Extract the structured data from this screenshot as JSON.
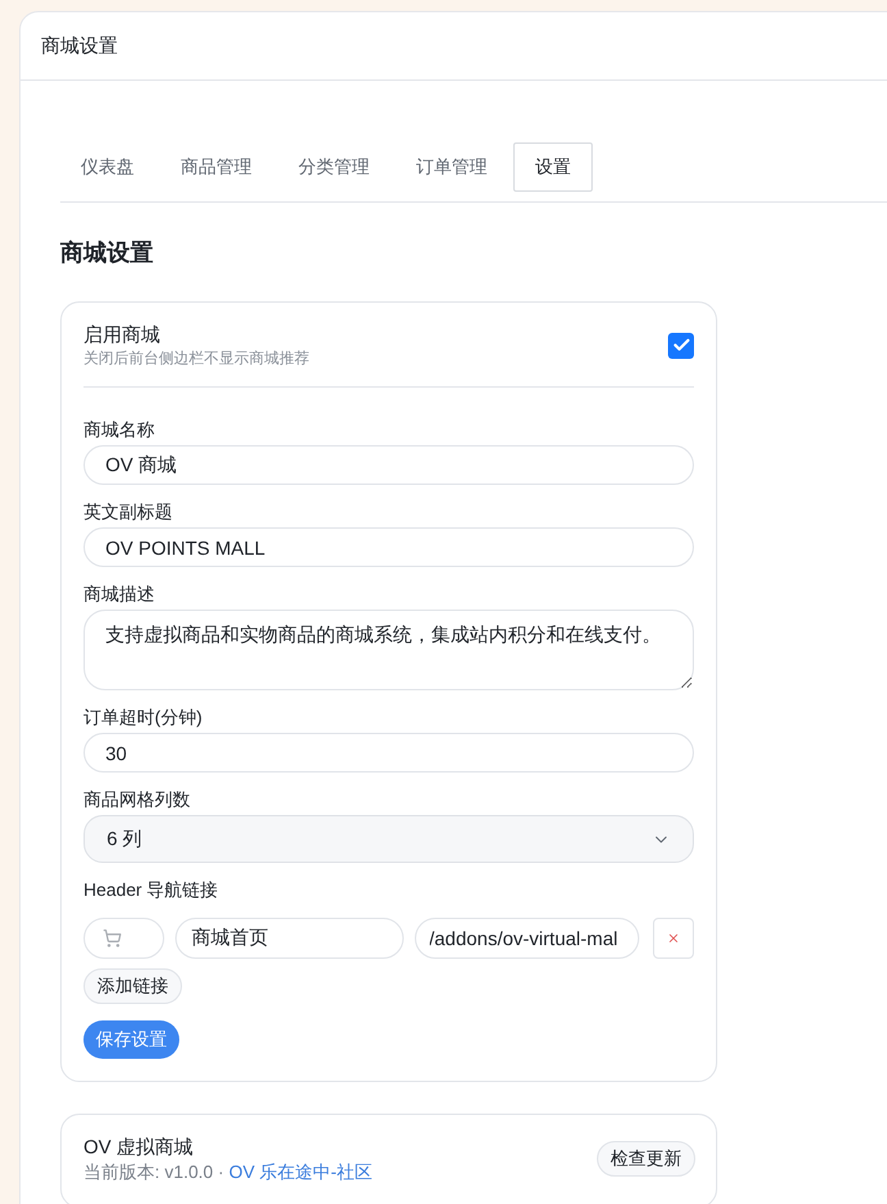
{
  "page": {
    "title": "商城设置"
  },
  "tabs": [
    {
      "label": "仪表盘",
      "selected": false
    },
    {
      "label": "商品管理",
      "selected": false
    },
    {
      "label": "分类管理",
      "selected": false
    },
    {
      "label": "订单管理",
      "selected": false
    },
    {
      "label": "设置",
      "selected": true
    }
  ],
  "section_title": "商城设置",
  "settings_card": {
    "enable": {
      "label": "启用商城",
      "description": "关闭后前台侧边栏不显示商城推荐",
      "checked": true
    },
    "fields": [
      {
        "kind": "text",
        "label": "商城名称",
        "value": "OV 商城"
      },
      {
        "kind": "text",
        "label": "英文副标题",
        "value": "OV POINTS MALL"
      },
      {
        "kind": "textarea",
        "label": "商城描述",
        "value": "支持虚拟商品和实物商品的商城系统，集成站内积分和在线支付。"
      },
      {
        "kind": "text",
        "label": "订单超时(分钟)",
        "value": "30"
      },
      {
        "kind": "select",
        "label": "商品网格列数",
        "value": "6 列"
      }
    ],
    "nav_links": {
      "label": "Header 导航链接",
      "links": [
        {
          "name": "商城首页",
          "url": "/addons/ov-virtual-mal"
        }
      ],
      "add_button": "添加链接"
    },
    "save_button": "保存设置"
  },
  "about_card": {
    "name": "OV 虚拟商城",
    "version": "当前版本: v1.0.0 ·",
    "link": "OV 乐在途中-社区",
    "button": "检查更新"
  }
}
